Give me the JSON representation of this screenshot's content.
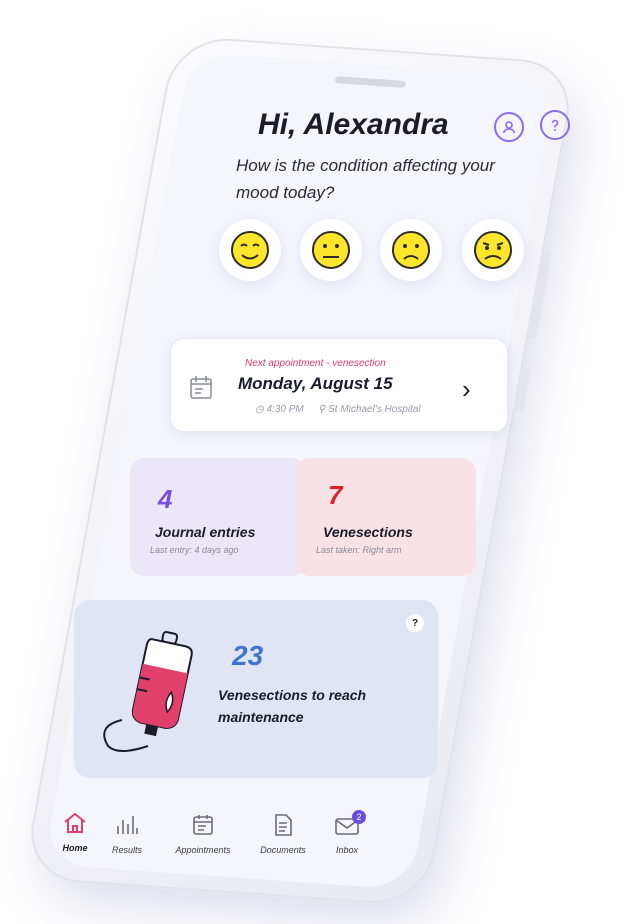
{
  "header": {
    "greeting": "Hi, Alexandra",
    "question": "How is the condition affecting your mood today?",
    "icons": [
      "profile-icon",
      "help-icon"
    ]
  },
  "moods": [
    {
      "name": "happy"
    },
    {
      "name": "neutral"
    },
    {
      "name": "sad"
    },
    {
      "name": "frustrated"
    }
  ],
  "appointment": {
    "kicker": "Next appointment - venesection",
    "date": "Monday, August 15",
    "time": "4:30 PM",
    "place": "St Michael's Hospital"
  },
  "stats": {
    "journal": {
      "count": "4",
      "label": "Journal entries",
      "sub": "Last entry: 4 days ago"
    },
    "venesections": {
      "count": "7",
      "label": "Venesections",
      "sub": "Last taken: Right arm"
    }
  },
  "maintenance": {
    "count": "23",
    "label": "Venesections to reach maintenance",
    "help": "?"
  },
  "nav": [
    {
      "label": "Home",
      "icon": "home-icon",
      "active": true
    },
    {
      "label": "Results",
      "icon": "bar-chart-icon"
    },
    {
      "label": "Appointments",
      "icon": "calendar-icon"
    },
    {
      "label": "Documents",
      "icon": "document-icon"
    },
    {
      "label": "Inbox",
      "icon": "envelope-icon",
      "badge": "2"
    }
  ],
  "colors": {
    "accent": "#8d6cf0",
    "appointment_kicker": "#e23b6b",
    "journal_number": "#7a4fe0",
    "venesection_number": "#e0202a",
    "maintenance_number": "#3f74d6",
    "journal_tile": "#ebe6f8",
    "venesection_tile": "#f9e2e6",
    "maintenance_card": "#dfe5f4"
  }
}
